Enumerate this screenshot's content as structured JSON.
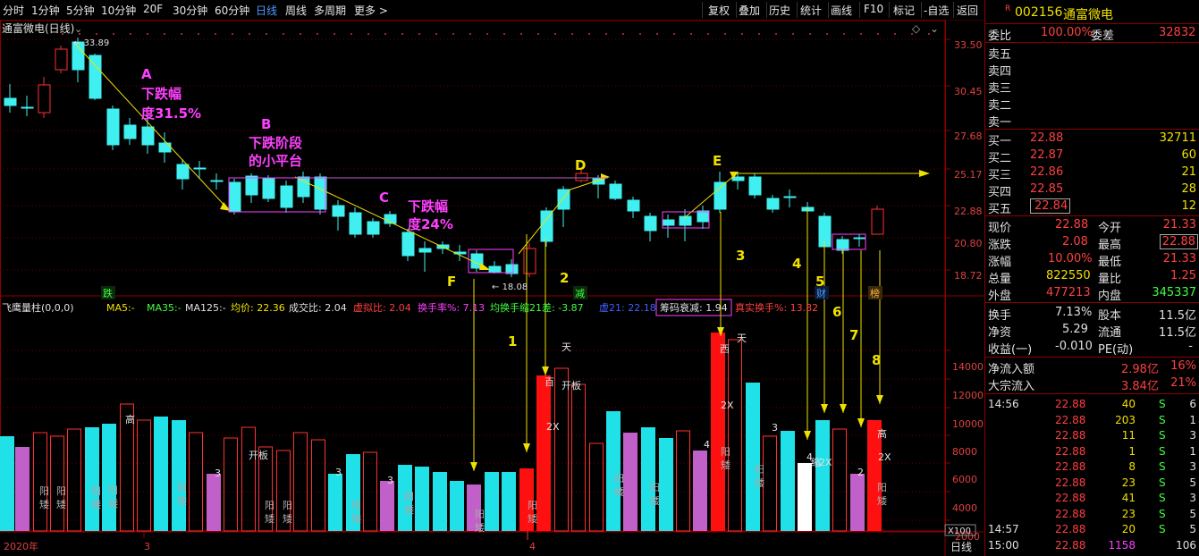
{
  "toolbar": {
    "left": [
      "分时",
      "1分钟",
      "5分钟",
      "10分钟",
      "20F",
      "30分钟",
      "60分钟",
      "日线",
      "周线",
      "多周期",
      "更多"
    ],
    "active_index": 7,
    "right": [
      "复权",
      "叠加",
      "历史",
      "统计",
      "画线",
      "F10",
      "标记",
      "-自选",
      "返回"
    ]
  },
  "chart": {
    "title": "通富微电(日线)",
    "high_label": "33.89",
    "low_label": "18.08",
    "price_axis": [
      "33.50",
      "30.45",
      "27.68",
      "25.17",
      "22.88",
      "20.80",
      "18.72"
    ],
    "annotations": [
      {
        "id": "A",
        "text": "A",
        "color": "#ff40ff"
      },
      {
        "id": "A2",
        "text": "下跌幅",
        "color": "#ff40ff"
      },
      {
        "id": "A3",
        "text": "度31.5%",
        "color": "#ff40ff"
      },
      {
        "id": "B",
        "text": "B",
        "color": "#ff40ff"
      },
      {
        "id": "B2",
        "text": "下跌阶段",
        "color": "#ff40ff"
      },
      {
        "id": "B3",
        "text": "的小平台",
        "color": "#ff40ff"
      },
      {
        "id": "C",
        "text": "C",
        "color": "#ff40ff"
      },
      {
        "id": "C2",
        "text": "下跌幅",
        "color": "#ff40ff"
      },
      {
        "id": "C3",
        "text": "度24%",
        "color": "#ff40ff"
      },
      {
        "id": "D",
        "text": "D",
        "color": "#f0e000"
      },
      {
        "id": "E",
        "text": "E",
        "color": "#f0e000"
      },
      {
        "id": "F",
        "text": "F",
        "color": "#f0e000"
      }
    ],
    "markers": [
      "跌",
      "减",
      "财",
      "榜"
    ],
    "numbers": [
      "1",
      "2",
      "3",
      "4",
      "5",
      "6",
      "7",
      "8"
    ]
  },
  "indicator": {
    "name": "飞鹰量柱(0,0,0)",
    "items": [
      {
        "t": "MA5:-",
        "c": "#f0e000"
      },
      {
        "t": "MA35:-",
        "c": "#40ff40"
      },
      {
        "t": "MA125:-",
        "c": "#e0e0e0"
      },
      {
        "t": "均价: 22.36",
        "c": "#f0e000"
      },
      {
        "t": "成交比: 2.04",
        "c": "#e0e0e0"
      },
      {
        "t": "虚拟比: 2.04",
        "c": "#ff4040"
      },
      {
        "t": "换手率%: 7.13",
        "c": "#ff40ff"
      },
      {
        "t": "均换手缩21差: -3.87",
        "c": "#40ff40"
      },
      {
        "t": "虚21: 22.18",
        "c": "#4060ff"
      },
      {
        "t": "筹码衰减: 1.94",
        "c": "#e0e0e0"
      },
      {
        "t": "真实换手%: 13.82",
        "c": "#ff4040"
      }
    ],
    "vol_axis": [
      "14000",
      "12000",
      "10000",
      "8000",
      "6000",
      "4000",
      "2000"
    ],
    "x100": "X100",
    "bar_labels": {
      "gao": "高",
      "yang": "阳",
      "ai": "矮",
      "kaiban": "开板",
      "tian": "天",
      "bai": "百",
      "x2": "2X",
      "xi": "西",
      "suo": "缩",
      "n3": "3",
      "n4": "4",
      "n2": "2"
    }
  },
  "bottombar": {
    "year": "2020年",
    "m3": "3",
    "m4": "4",
    "mode": "日线"
  },
  "quote": {
    "code": "002156",
    "name": "通富微电",
    "r_badge": "R",
    "weibi_label": "委比",
    "weibi": "100.00%",
    "weicha_label": "委差",
    "weicha": "32832",
    "sell": [
      {
        "l": "卖五",
        "p": "",
        "v": ""
      },
      {
        "l": "卖四",
        "p": "",
        "v": ""
      },
      {
        "l": "卖三",
        "p": "",
        "v": ""
      },
      {
        "l": "卖二",
        "p": "",
        "v": ""
      },
      {
        "l": "卖一",
        "p": "",
        "v": ""
      }
    ],
    "buy": [
      {
        "l": "买一",
        "p": "22.88",
        "v": "32711"
      },
      {
        "l": "买二",
        "p": "22.87",
        "v": "60"
      },
      {
        "l": "买三",
        "p": "22.86",
        "v": "21"
      },
      {
        "l": "买四",
        "p": "22.85",
        "v": "28"
      },
      {
        "l": "买五",
        "p": "22.84",
        "v": "12"
      }
    ],
    "stats": [
      {
        "l1": "现价",
        "v1": "22.88",
        "l2": "今开",
        "v2": "21.33"
      },
      {
        "l1": "涨跌",
        "v1": "2.08",
        "l2": "最高",
        "v2": "22.88"
      },
      {
        "l1": "涨幅",
        "v1": "10.00%",
        "l2": "最低",
        "v2": "21.33"
      },
      {
        "l1": "总量",
        "v1": "822550",
        "l2": "量比",
        "v2": "1.25"
      },
      {
        "l1": "外盘",
        "v1": "477213",
        "l2": "内盘",
        "v2": "345337"
      }
    ],
    "fund": [
      {
        "l1": "换手",
        "v1": "7.13%",
        "l2": "股本",
        "v2": "11.5亿"
      },
      {
        "l1": "净资",
        "v1": "5.29",
        "l2": "流通",
        "v2": "11.5亿"
      },
      {
        "l1": "收益(一)",
        "v1": "-0.010",
        "l2": "PE(动)",
        "v2": "-"
      }
    ],
    "flow": [
      {
        "l": "净流入额",
        "v": "2.98亿",
        "p": "16%"
      },
      {
        "l": "大宗流入",
        "v": "3.84亿",
        "p": "21%"
      }
    ],
    "ticks": [
      {
        "t": "14:56",
        "p": "22.88",
        "v": "40",
        "s": "S",
        "n": "6"
      },
      {
        "t": "",
        "p": "22.88",
        "v": "203",
        "s": "S",
        "n": "1"
      },
      {
        "t": "",
        "p": "22.88",
        "v": "11",
        "s": "S",
        "n": "3"
      },
      {
        "t": "",
        "p": "22.88",
        "v": "1",
        "s": "S",
        "n": "1"
      },
      {
        "t": "",
        "p": "22.88",
        "v": "8",
        "s": "S",
        "n": "3"
      },
      {
        "t": "",
        "p": "22.88",
        "v": "23",
        "s": "S",
        "n": "5"
      },
      {
        "t": "",
        "p": "22.88",
        "v": "41",
        "s": "S",
        "n": "3"
      },
      {
        "t": "",
        "p": "22.88",
        "v": "23",
        "s": "S",
        "n": "5"
      },
      {
        "t": "14:57",
        "p": "22.88",
        "v": "20",
        "s": "S",
        "n": "5"
      },
      {
        "t": "15:00",
        "p": "22.88",
        "v": "1158",
        "s": "",
        "n": "106"
      }
    ]
  }
}
